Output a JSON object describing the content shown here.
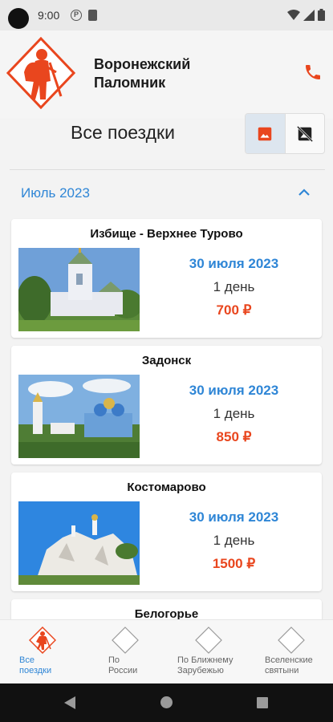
{
  "status_bar": {
    "time": "9:00",
    "p_badge": "P"
  },
  "header": {
    "title_line1": "Воронежский",
    "title_line2": "Паломник"
  },
  "page": {
    "title": "Все поездки"
  },
  "section": {
    "title": "Июль 2023"
  },
  "trips": [
    {
      "title": "Избище - Верхнее Турово",
      "date": "30 июля 2023",
      "duration": "1 день",
      "price": "700 ₽"
    },
    {
      "title": "Задонск",
      "date": "30 июля 2023",
      "duration": "1 день",
      "price": "850 ₽"
    },
    {
      "title": "Костомарово",
      "date": "30 июля 2023",
      "duration": "1 день",
      "price": "1500 ₽"
    },
    {
      "title": "Белогорье"
    }
  ],
  "bottom_nav": [
    {
      "label_line1": "Все",
      "label_line2": "поездки"
    },
    {
      "label_line1": "По",
      "label_line2": "России"
    },
    {
      "label_line1": "По Ближнему",
      "label_line2": "Зарубежью"
    },
    {
      "label_line1": "Вселенские",
      "label_line2": "святыни"
    }
  ],
  "colors": {
    "accent": "#2f86d6",
    "brand": "#e9461e"
  },
  "icons": {
    "phone": "phone-icon",
    "image": "image-icon",
    "no_image": "hide-image-icon",
    "chevron": "chevron-up-icon"
  }
}
